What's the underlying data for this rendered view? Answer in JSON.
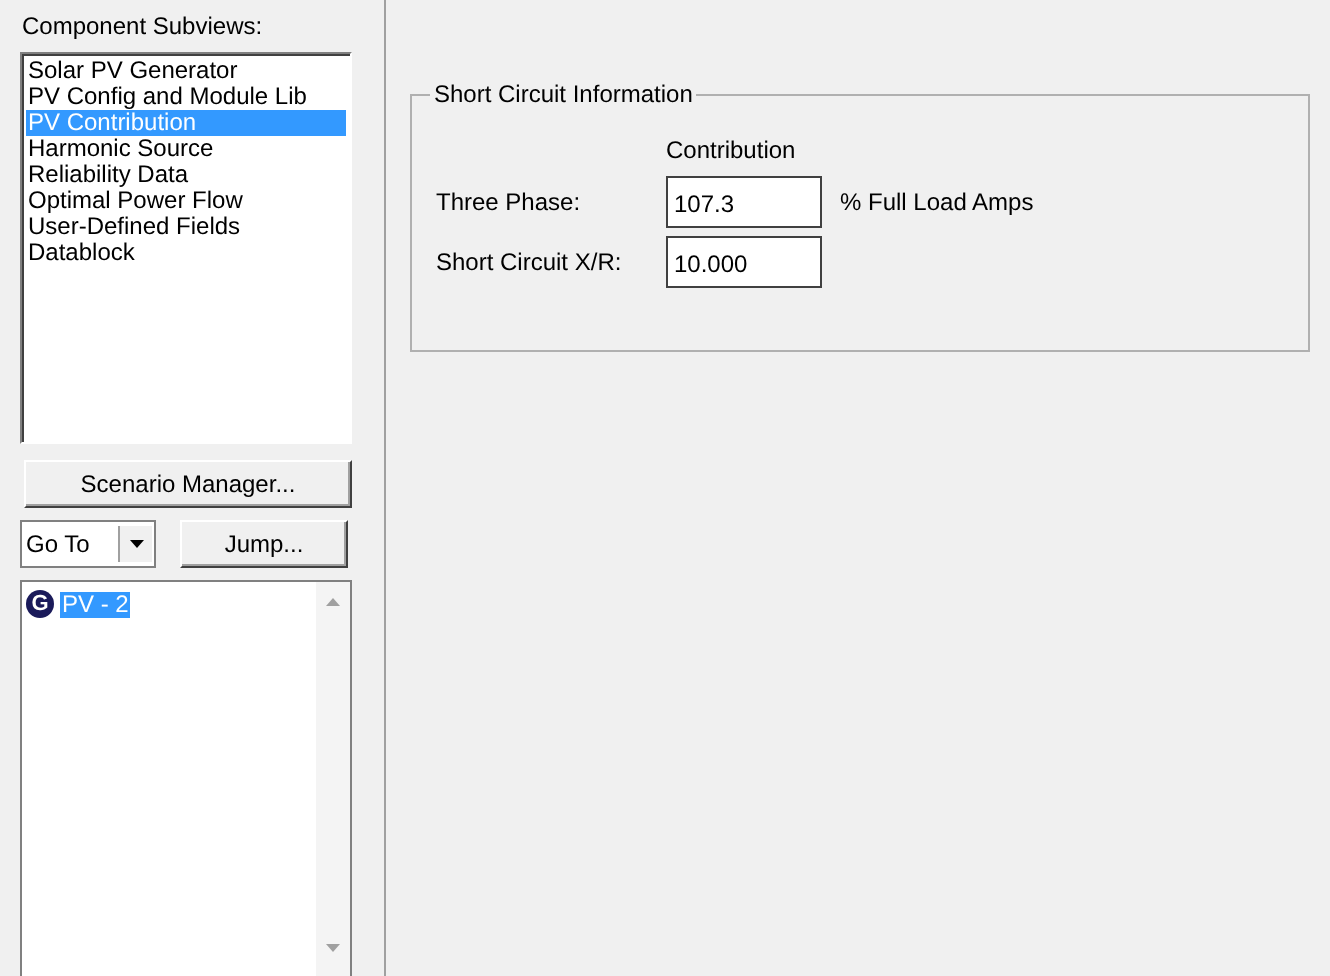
{
  "sidebar": {
    "title": "Component Subviews:",
    "items": [
      {
        "label": "Solar PV Generator",
        "selected": false
      },
      {
        "label": "PV Config and Module Lib",
        "selected": false
      },
      {
        "label": "PV Contribution",
        "selected": true
      },
      {
        "label": "Harmonic Source",
        "selected": false
      },
      {
        "label": "Reliability Data",
        "selected": false
      },
      {
        "label": "Optimal Power Flow",
        "selected": false
      },
      {
        "label": "User-Defined Fields",
        "selected": false
      },
      {
        "label": "Datablock",
        "selected": false
      }
    ],
    "scenario_button": "Scenario Manager...",
    "goto": {
      "value": "Go To"
    },
    "jump_button": "Jump...",
    "tree": [
      {
        "icon": "G",
        "label": "PV - 2",
        "selected": true
      }
    ]
  },
  "group": {
    "title": "Short Circuit Information",
    "column_header": "Contribution",
    "rows": [
      {
        "label": "Three Phase:",
        "value": "107.3",
        "unit": "% Full Load Amps"
      },
      {
        "label": "Short Circuit X/R:",
        "value": "10.000"
      }
    ]
  }
}
